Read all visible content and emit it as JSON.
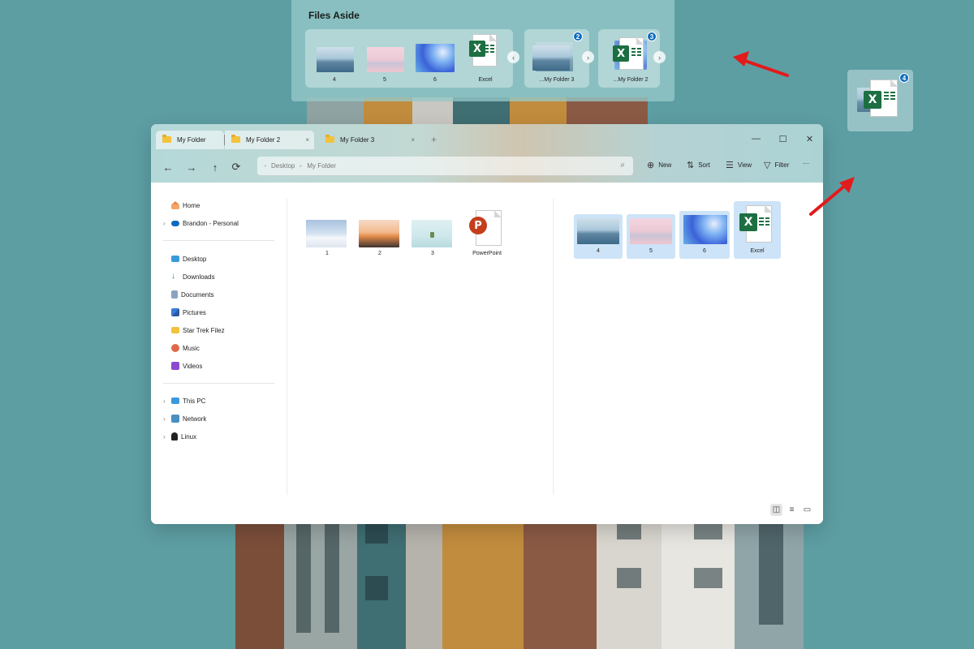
{
  "files_aside": {
    "title": "Files Aside",
    "group1": [
      {
        "label": "4",
        "icon": "image-thumbnail-sea"
      },
      {
        "label": "5",
        "icon": "image-thumbnail-pink"
      },
      {
        "label": "6",
        "icon": "image-thumbnail-blue"
      },
      {
        "label": "Excel",
        "icon": "excel-icon"
      }
    ],
    "stack1": {
      "label": "...My Folder 3",
      "count": "2"
    },
    "stack2": {
      "label": "...My Folder 2",
      "count": "3"
    }
  },
  "drag_tile": {
    "count": "4",
    "icon": "excel-stack-icon"
  },
  "explorer": {
    "tabs": [
      {
        "label": "My Folder",
        "active": true
      },
      {
        "label": "My Folder 2",
        "active": true,
        "close": "×"
      },
      {
        "label": "My Folder 3",
        "active": false,
        "close": "×"
      }
    ],
    "new_tab": "+",
    "window_controls": {
      "minimize": "—",
      "maximize": "☐",
      "close": "✕"
    },
    "address": {
      "parts": [
        "Desktop",
        "My Folder"
      ]
    },
    "commands": {
      "new": "New",
      "sort": "Sort",
      "view": "View",
      "filter": "Filter",
      "more": "···"
    },
    "sidebar": {
      "top": [
        {
          "label": "Home",
          "icon": "home-icon",
          "chevron": false
        },
        {
          "label": "Brandon - Personal",
          "icon": "onedrive-icon",
          "chevron": true
        }
      ],
      "places": [
        {
          "label": "Desktop",
          "icon": "desktop-icon"
        },
        {
          "label": "Downloads",
          "icon": "download-icon"
        },
        {
          "label": "Documents",
          "icon": "documents-icon"
        },
        {
          "label": "Pictures",
          "icon": "pictures-icon"
        },
        {
          "label": "Star Trek Filez",
          "icon": "folder-icon"
        },
        {
          "label": "Music",
          "icon": "music-icon"
        },
        {
          "label": "Videos",
          "icon": "videos-icon"
        }
      ],
      "devices": [
        {
          "label": "This PC",
          "icon": "pc-icon"
        },
        {
          "label": "Network",
          "icon": "network-icon"
        },
        {
          "label": "Linux",
          "icon": "linux-icon"
        }
      ]
    },
    "left_pane": [
      {
        "label": "1",
        "icon": "image-thumbnail-snow"
      },
      {
        "label": "2",
        "icon": "image-thumbnail-sunset"
      },
      {
        "label": "3",
        "icon": "image-thumbnail-mint"
      },
      {
        "label": "PowerPoint",
        "icon": "powerpoint-icon"
      }
    ],
    "right_pane": [
      {
        "label": "4",
        "icon": "image-thumbnail-sea",
        "selected": true
      },
      {
        "label": "5",
        "icon": "image-thumbnail-pink",
        "selected": true
      },
      {
        "label": "6",
        "icon": "image-thumbnail-blue",
        "selected": true
      },
      {
        "label": "Excel",
        "icon": "excel-icon",
        "selected": true
      }
    ]
  },
  "colors": {
    "desktop_bg": "#5d9ea3",
    "accent": "#0f6cbd",
    "selection": "#cde3f7",
    "excel_green": "#1d6f42",
    "powerpoint_red": "#c43e1c",
    "annotation_arrow": "#e21b1b"
  }
}
